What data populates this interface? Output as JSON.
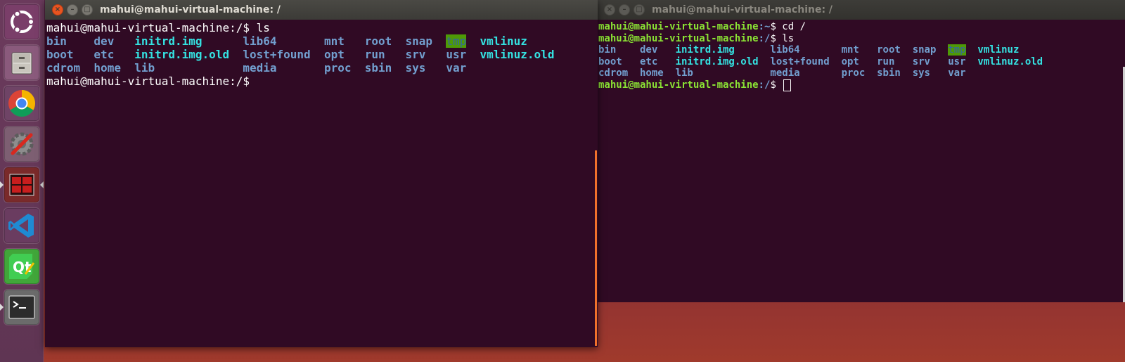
{
  "launcher": {
    "items": [
      {
        "name": "ubuntu-dash-icon",
        "bg": "#7a3e69"
      },
      {
        "name": "files-icon",
        "bg": "#8a5a7c"
      },
      {
        "name": "chrome-icon",
        "bg": "#6f4466"
      },
      {
        "name": "system-settings-icon",
        "bg": "#7d5f72"
      },
      {
        "name": "remmina-icon",
        "bg": "#7a2a2a"
      },
      {
        "name": "vscode-icon",
        "bg": "#3a6ea8"
      },
      {
        "name": "qt-creator-icon",
        "bg": "#41a63a"
      },
      {
        "name": "terminal-icon",
        "bg": "#6b6b6b"
      }
    ]
  },
  "left_window": {
    "title": "mahui@mahui-virtual-machine: /",
    "lines": [
      {
        "user": "mahui@mahui-virtual-machine",
        "path": ":/",
        "dollar": "$ ",
        "cmd": "ls"
      }
    ],
    "ls_rows": [
      [
        "bin",
        "dev",
        "initrd.img",
        "lib64",
        "mnt",
        "root",
        "snap",
        "tmp",
        "vmlinuz"
      ],
      [
        "boot",
        "etc",
        "initrd.img.old",
        "lost+found",
        "opt",
        "run",
        "srv",
        "usr",
        "vmlinuz.old"
      ],
      [
        "cdrom",
        "home",
        "lib",
        "media",
        "proc",
        "sbin",
        "sys",
        "var",
        ""
      ]
    ],
    "final_prompt": {
      "user": "mahui@mahui-virtual-machine",
      "path": ":/",
      "dollar": "$"
    }
  },
  "right_window": {
    "title": "mahui@mahui-virtual-machine: /",
    "lines": [
      {
        "user": "mahui@mahui-virtual-machine",
        "path": ":~",
        "dollar": "$ ",
        "cmd": "cd /"
      },
      {
        "user": "mahui@mahui-virtual-machine",
        "path": ":/",
        "dollar": "$ ",
        "cmd": "ls"
      }
    ],
    "ls_rows": [
      [
        "bin",
        "dev",
        "initrd.img",
        "lib64",
        "mnt",
        "root",
        "snap",
        "tmp",
        "vmlinuz"
      ],
      [
        "boot",
        "etc",
        "initrd.img.old",
        "lost+found",
        "opt",
        "run",
        "srv",
        "usr",
        "vmlinuz.old"
      ],
      [
        "cdrom",
        "home",
        "lib",
        "media",
        "proc",
        "sbin",
        "sys",
        "var",
        ""
      ]
    ],
    "final_prompt": {
      "user": "mahui@mahui-virtual-machine",
      "path": ":/",
      "dollar": "$ "
    }
  },
  "colors": {
    "terminal_bg": "#300a24",
    "directory": "#729fcf",
    "symlink": "#34e2e2",
    "sticky_dir_bg": "#4e9a06",
    "prompt_user": "#8ae234",
    "accent": "#e95420"
  }
}
